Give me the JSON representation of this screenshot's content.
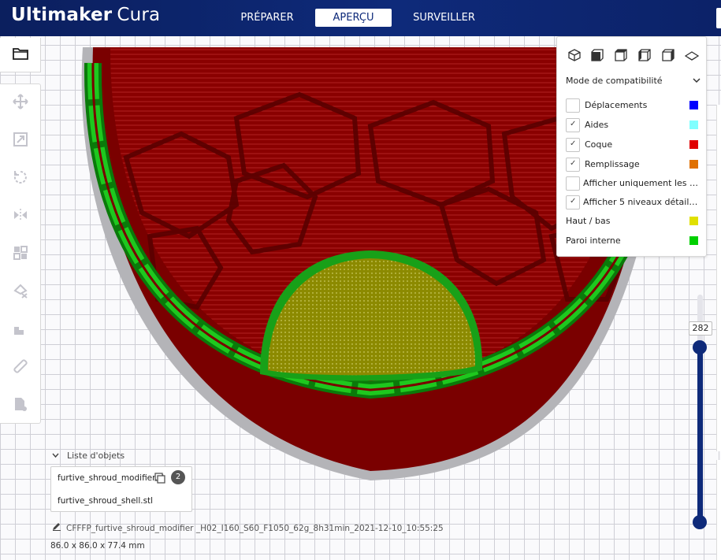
{
  "app": {
    "brand": "Ultimaker",
    "product": "Cura"
  },
  "stages": [
    {
      "label": "PRÉPARER",
      "active": false
    },
    {
      "label": "APERÇU",
      "active": true
    },
    {
      "label": "SURVEILLER",
      "active": false
    }
  ],
  "toolbar": {
    "tools": [
      "move-icon",
      "scale-icon",
      "rotate-icon",
      "mirror-icon",
      "per-model-settings-icon",
      "support-blocker-icon",
      "support-eraser-icon",
      "measure-icon",
      "mesh-tools-icon"
    ]
  },
  "view_panel": {
    "camera_icons": [
      "3d-view-icon",
      "front-view-icon",
      "top-view-icon",
      "left-view-icon",
      "right-view-icon",
      "layer-view-icon"
    ],
    "mode": "Mode de compatibilité",
    "legend": [
      {
        "label": "Déplacements",
        "checked": false,
        "color": "#0000ff"
      },
      {
        "label": "Aides",
        "checked": true,
        "color": "#80ffff"
      },
      {
        "label": "Coque",
        "checked": true,
        "color": "#e00000"
      },
      {
        "label": "Remplissage",
        "checked": true,
        "color": "#e07000"
      },
      {
        "label": "Afficher uniquement les c...",
        "checked": false
      },
      {
        "label": "Afficher 5 niveaux détaillé...",
        "checked": true
      },
      {
        "label": "Haut / bas",
        "color": "#e0e000"
      },
      {
        "label": "Paroi interne",
        "color": "#00d000"
      }
    ]
  },
  "layer_slider": {
    "value": "282"
  },
  "object_list": {
    "header": "Liste d'objets",
    "items": [
      "furtive_shroud_modifier.stl",
      "furtive_shroud_shell.stl"
    ],
    "count": "2"
  },
  "job_name": "CFFFP_furtive_shroud_modifier _H02_I160_S60_F1050_62g_8h31min_2021-12-10_10:55:25",
  "dimensions": "86.0 x 86.0 x 77.4 mm",
  "colors": {
    "header": "#0e2a7a",
    "shell": "#8a0000",
    "inner_wall": "#18b418",
    "top_bottom": "#8a8a00"
  }
}
